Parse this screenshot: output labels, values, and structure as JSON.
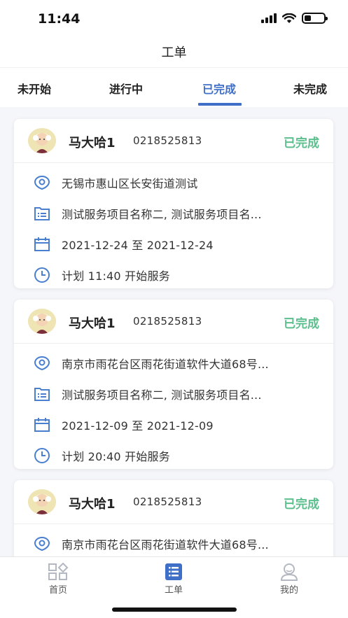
{
  "status_bar": {
    "time": "11:44"
  },
  "nav": {
    "title": "工单"
  },
  "tabs": [
    {
      "label": "未开始",
      "active": false
    },
    {
      "label": "进行中",
      "active": false
    },
    {
      "label": "已完成",
      "active": true
    },
    {
      "label": "未完成",
      "active": false
    }
  ],
  "orders": [
    {
      "name": "马大哈1",
      "phone": "0218525813",
      "status": "已完成",
      "address": "无锡市惠山区长安街道测试",
      "services": "测试服务项目名称二, 测试服务项目名...",
      "date_range": "2021-12-24 至 2021-12-24",
      "plan": "计划 11:40 开始服务"
    },
    {
      "name": "马大哈1",
      "phone": "0218525813",
      "status": "已完成",
      "address": "南京市雨花台区雨花街道软件大道68号...",
      "services": "测试服务项目名称二, 测试服务项目名...",
      "date_range": "2021-12-09 至 2021-12-09",
      "plan": "计划 20:40 开始服务"
    },
    {
      "name": "马大哈1",
      "phone": "0218525813",
      "status": "已完成",
      "address": "南京市雨花台区雨花街道软件大道68号..."
    }
  ],
  "tabbar": [
    {
      "label": "首页",
      "icon": "grid-icon",
      "active": false
    },
    {
      "label": "工单",
      "icon": "list-icon",
      "active": true
    },
    {
      "label": "我的",
      "icon": "user-icon",
      "active": false
    }
  ],
  "colors": {
    "accent": "#3f6fc7",
    "status_done": "#5cbf8e",
    "background": "#f4f6f9"
  }
}
